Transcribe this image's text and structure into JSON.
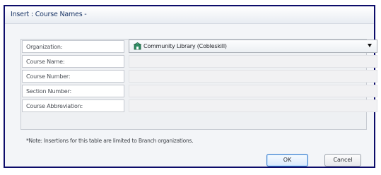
{
  "dialog": {
    "title": "Insert : Course Names -"
  },
  "form": {
    "organization": {
      "label": "Organization:",
      "selected": "Community Library (Cobleskill)",
      "icon": "library-building-icon"
    },
    "course_name": {
      "label": "Course Name:",
      "value": ""
    },
    "course_number": {
      "label": "Course Number:",
      "value": ""
    },
    "section_number": {
      "label": "Section Number:",
      "value": ""
    },
    "course_abbreviation": {
      "label": "Course Abbreviation:",
      "value": ""
    }
  },
  "note": "*Note: Insertions for this table are limited to Branch organizations.",
  "buttons": {
    "ok": "OK",
    "cancel": "Cancel"
  },
  "colors": {
    "border": "#0c0c6a",
    "title_text": "#1a3566",
    "ok_border": "#3c7ac7"
  }
}
